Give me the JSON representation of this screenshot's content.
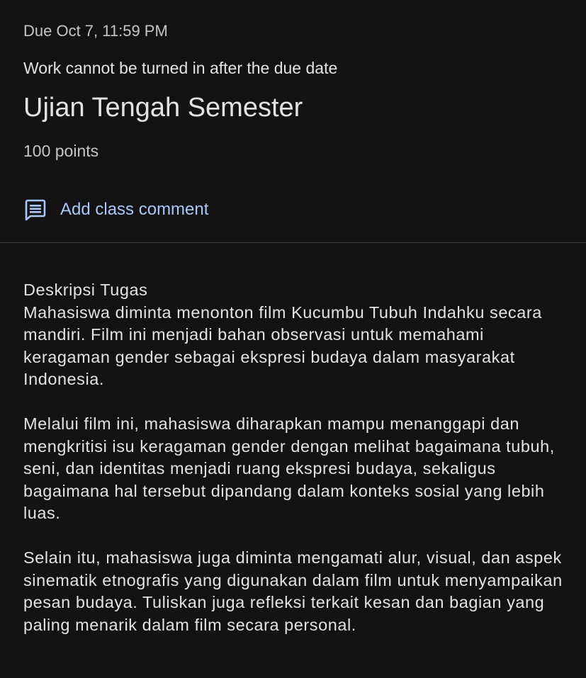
{
  "assignment": {
    "due": "Due Oct 7, 11:59 PM",
    "late_note": "Work cannot be turned in after the due date",
    "title": "Ujian Tengah Semester",
    "points": "100 points"
  },
  "comment": {
    "icon": "comment-icon",
    "label": "Add class comment",
    "color": "#a8c7fa"
  },
  "description": {
    "heading": "Deskripsi Tugas",
    "paragraphs": [
      "Mahasiswa diminta menonton film Kucumbu Tubuh Indahku secara mandiri. Film ini menjadi bahan observasi untuk memahami keragaman gender sebagai ekspresi budaya dalam masyarakat Indonesia.",
      "Melalui film ini, mahasiswa diharapkan mampu menanggapi dan mengkritisi isu keragaman gender dengan melihat bagaimana tubuh, seni, dan identitas menjadi ruang ekspresi budaya, sekaligus bagaimana hal tersebut dipandang dalam konteks sosial yang lebih luas.",
      "Selain itu, mahasiswa juga diminta mengamati alur, visual, dan aspek sinematik etnografis yang digunakan dalam film untuk menyampaikan pesan budaya. Tuliskan juga refleksi terkait kesan dan bagian yang paling menarik dalam film secara personal."
    ]
  },
  "colors": {
    "background": "#131314",
    "text": "#e3e3e3",
    "secondary_text": "#c4c7c5",
    "accent": "#a8c7fa",
    "divider": "#444746"
  }
}
